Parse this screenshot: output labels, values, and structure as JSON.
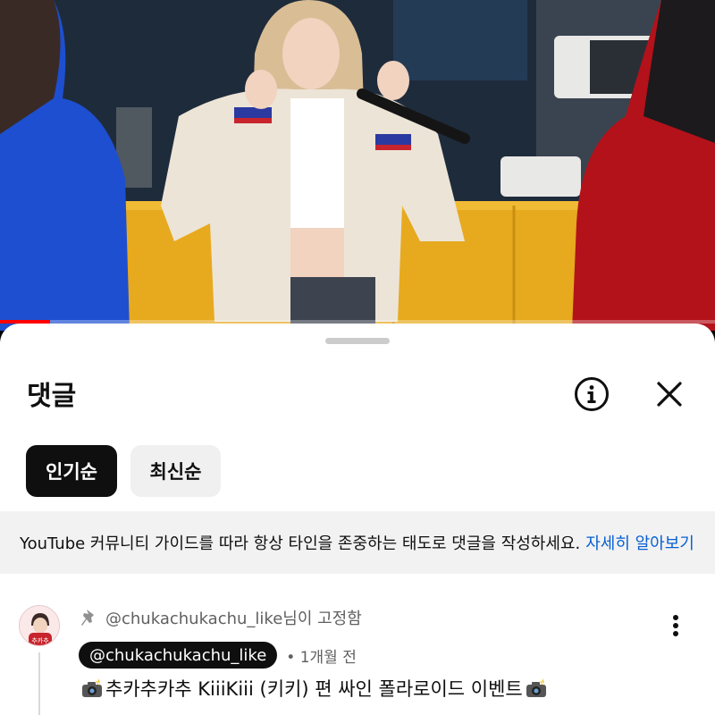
{
  "video": {
    "progress_fraction": 0.07
  },
  "sheet": {
    "title": "댓글",
    "info_icon": "info-icon",
    "close_icon": "close-icon"
  },
  "sort_chips": [
    {
      "label": "인기순",
      "active": true
    },
    {
      "label": "최신순",
      "active": false
    }
  ],
  "guidelines": {
    "text": "YouTube 커뮤니티 가이드를 따라 항상 타인을 존중하는 태도로 댓글을 작성하세요.",
    "link": "자세히 알아보기"
  },
  "comment": {
    "pinned_label": "@chukachukachu_like님이 고정함",
    "pin_icon": "pin-icon",
    "author": "@chukachukachu_like",
    "meta": "• 1개월 전",
    "text": "추카추카추 KiiiKiii (키키) 편 싸인 폴라로이드 이벤트",
    "text_icon": "camera-flash-icon",
    "avatar_text": "추카추",
    "menu_icon": "more-vertical-icon"
  },
  "colors": {
    "accent_link": "#065fd4",
    "chip_active_bg": "#0f0f0f",
    "chip_inactive_bg": "#f0f0f0",
    "progress": "#ff0000"
  }
}
